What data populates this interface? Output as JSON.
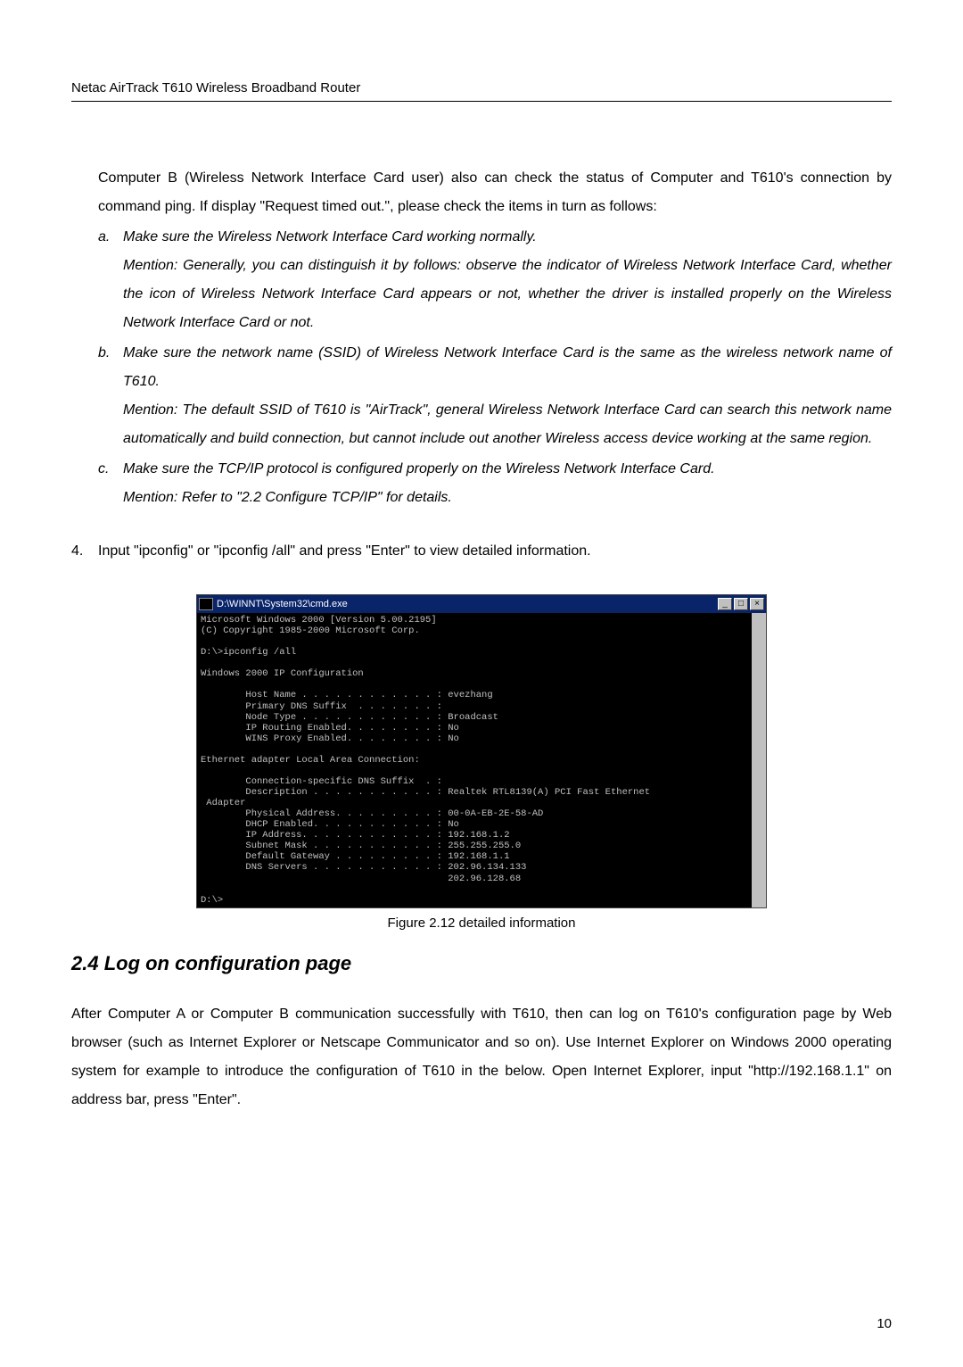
{
  "header": {
    "title": "Netac AirTrack T610 Wireless Broadband Router"
  },
  "intro": "Computer B (Wireless Network Interface Card user) also can check the status of Computer and T610's connection by command ping. If display \"Request timed out.\", please check the items in turn as follows:",
  "steps": [
    {
      "marker": "a.",
      "text": "Make sure the Wireless Network Interface Card working normally.\nMention: Generally, you can distinguish it by follows: observe the indicator of Wireless Network Interface Card, whether the icon of Wireless Network Interface Card appears or not, whether the driver is installed properly on the Wireless Network Interface Card or not."
    },
    {
      "marker": "b.",
      "text": "Make sure the network name (SSID) of Wireless Network Interface Card is the same as the wireless network name of T610.\nMention: The default SSID of T610 is \"AirTrack\", general Wireless Network Interface Card can search this network name automatically and build connection, but cannot include out another Wireless access device working at the same region."
    },
    {
      "marker": "c.",
      "text": "Make sure the TCP/IP protocol is configured properly on the Wireless Network Interface Card.\nMention: Refer to \"2.2 Configure TCP/IP\" for details."
    }
  ],
  "numbered": {
    "marker": "4.",
    "text": "Input \"ipconfig\" or \"ipconfig /all\" and press \"Enter\" to view detailed information."
  },
  "cmd": {
    "title": "D:\\WINNT\\System32\\cmd.exe",
    "content": "Microsoft Windows 2000 [Version 5.00.2195]\n(C) Copyright 1985-2000 Microsoft Corp.\n\nD:\\>ipconfig /all\n\nWindows 2000 IP Configuration\n\n        Host Name . . . . . . . . . . . . : evezhang\n        Primary DNS Suffix  . . . . . . . :\n        Node Type . . . . . . . . . . . . : Broadcast\n        IP Routing Enabled. . . . . . . . : No\n        WINS Proxy Enabled. . . . . . . . : No\n\nEthernet adapter Local Area Connection:\n\n        Connection-specific DNS Suffix  . :\n        Description . . . . . . . . . . . : Realtek RTL8139(A) PCI Fast Ethernet\n Adapter\n        Physical Address. . . . . . . . . : 00-0A-EB-2E-58-AD\n        DHCP Enabled. . . . . . . . . . . : No\n        IP Address. . . . . . . . . . . . : 192.168.1.2\n        Subnet Mask . . . . . . . . . . . : 255.255.255.0\n        Default Gateway . . . . . . . . . : 192.168.1.1\n        DNS Servers . . . . . . . . . . . : 202.96.134.133\n                                            202.96.128.68\n\nD:\\>"
  },
  "figure_caption": "Figure 2.12 detailed information",
  "section_heading": "2.4 Log on configuration page",
  "section_body": "After Computer A or Computer B communication successfully with T610, then can log on T610's configuration page by Web browser (such as Internet Explorer or Netscape Communicator and so on). Use Internet Explorer on Windows 2000 operating system for example to introduce the configuration of T610 in the below. Open Internet Explorer, input \"http://192.168.1.1\" on address bar, press \"Enter\".",
  "page_number": "10",
  "win_buttons": {
    "min": "_",
    "max": "□",
    "close": "×",
    "up": "▲",
    "down": "▼"
  }
}
